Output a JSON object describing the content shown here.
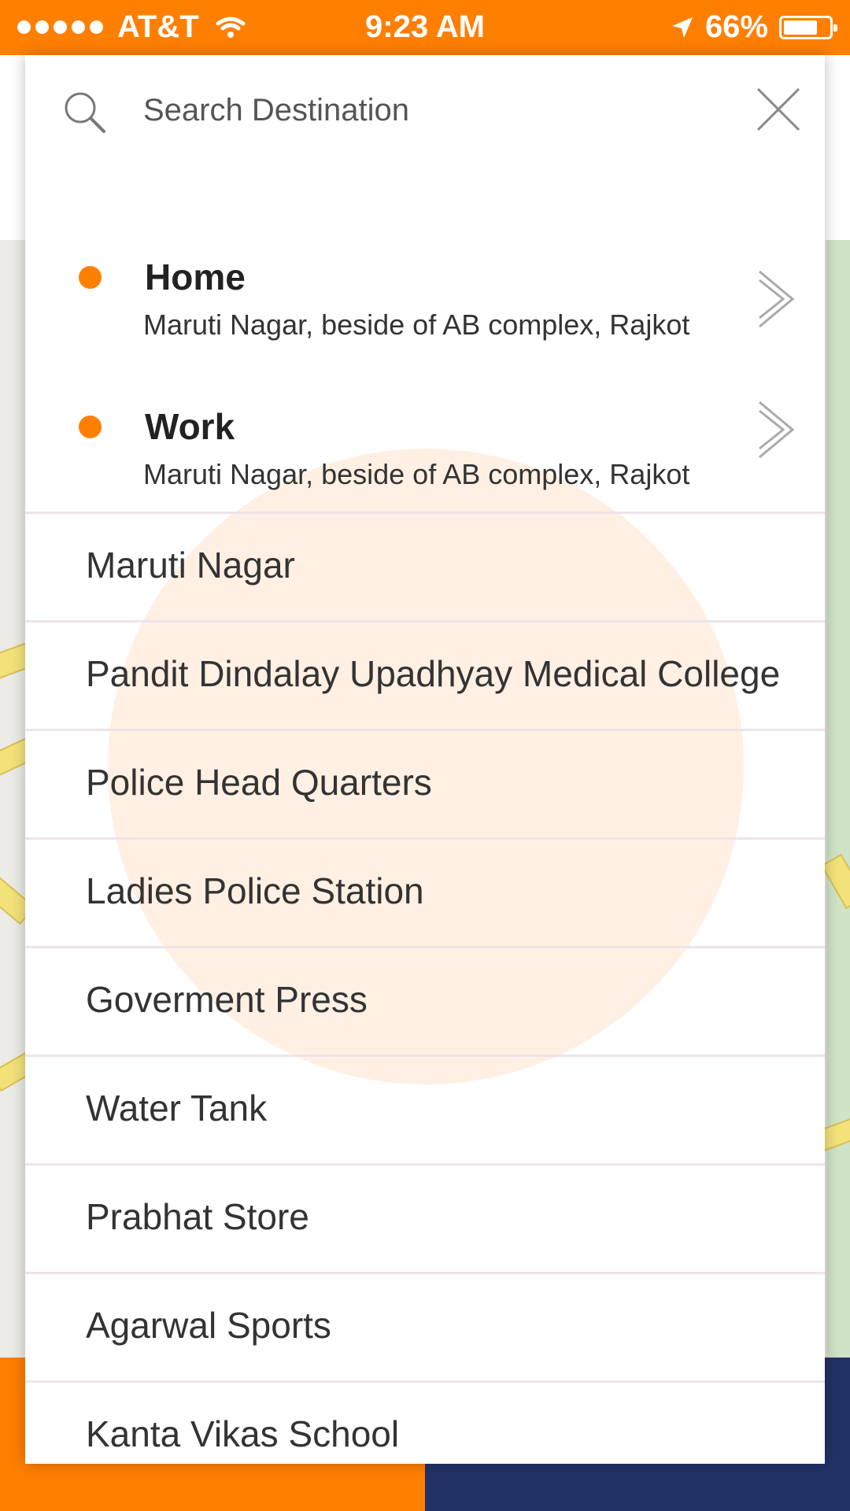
{
  "status_bar": {
    "carrier": "AT&T",
    "time": "9:23 AM",
    "battery": "66%",
    "battery_level": 0.66
  },
  "search": {
    "placeholder": "Search Destination"
  },
  "saved_places": [
    {
      "title": "Home",
      "address": "Maruti Nagar, beside of AB complex, Rajkot"
    },
    {
      "title": "Work",
      "address": "Maruti Nagar, beside of AB complex, Rajkot"
    }
  ],
  "results": [
    "Maruti Nagar",
    "Pandit Dindalay Upadhyay Medical College",
    "Police Head Quarters",
    "Ladies Police Station",
    "Goverment Press",
    "Water Tank",
    "Prabhat Store",
    "Agarwal Sports",
    "Kanta Vikas School"
  ],
  "colors": {
    "accent": "#FF7F00",
    "ripple": "#FFF0E3",
    "navy": "#233266",
    "divider": "#efe3ea"
  },
  "icons": {
    "search": "search-icon",
    "close": "close-icon",
    "chevron": "chevron-right-icon",
    "location": "location-arrow-icon",
    "wifi": "wifi-icon",
    "battery": "battery-icon"
  }
}
